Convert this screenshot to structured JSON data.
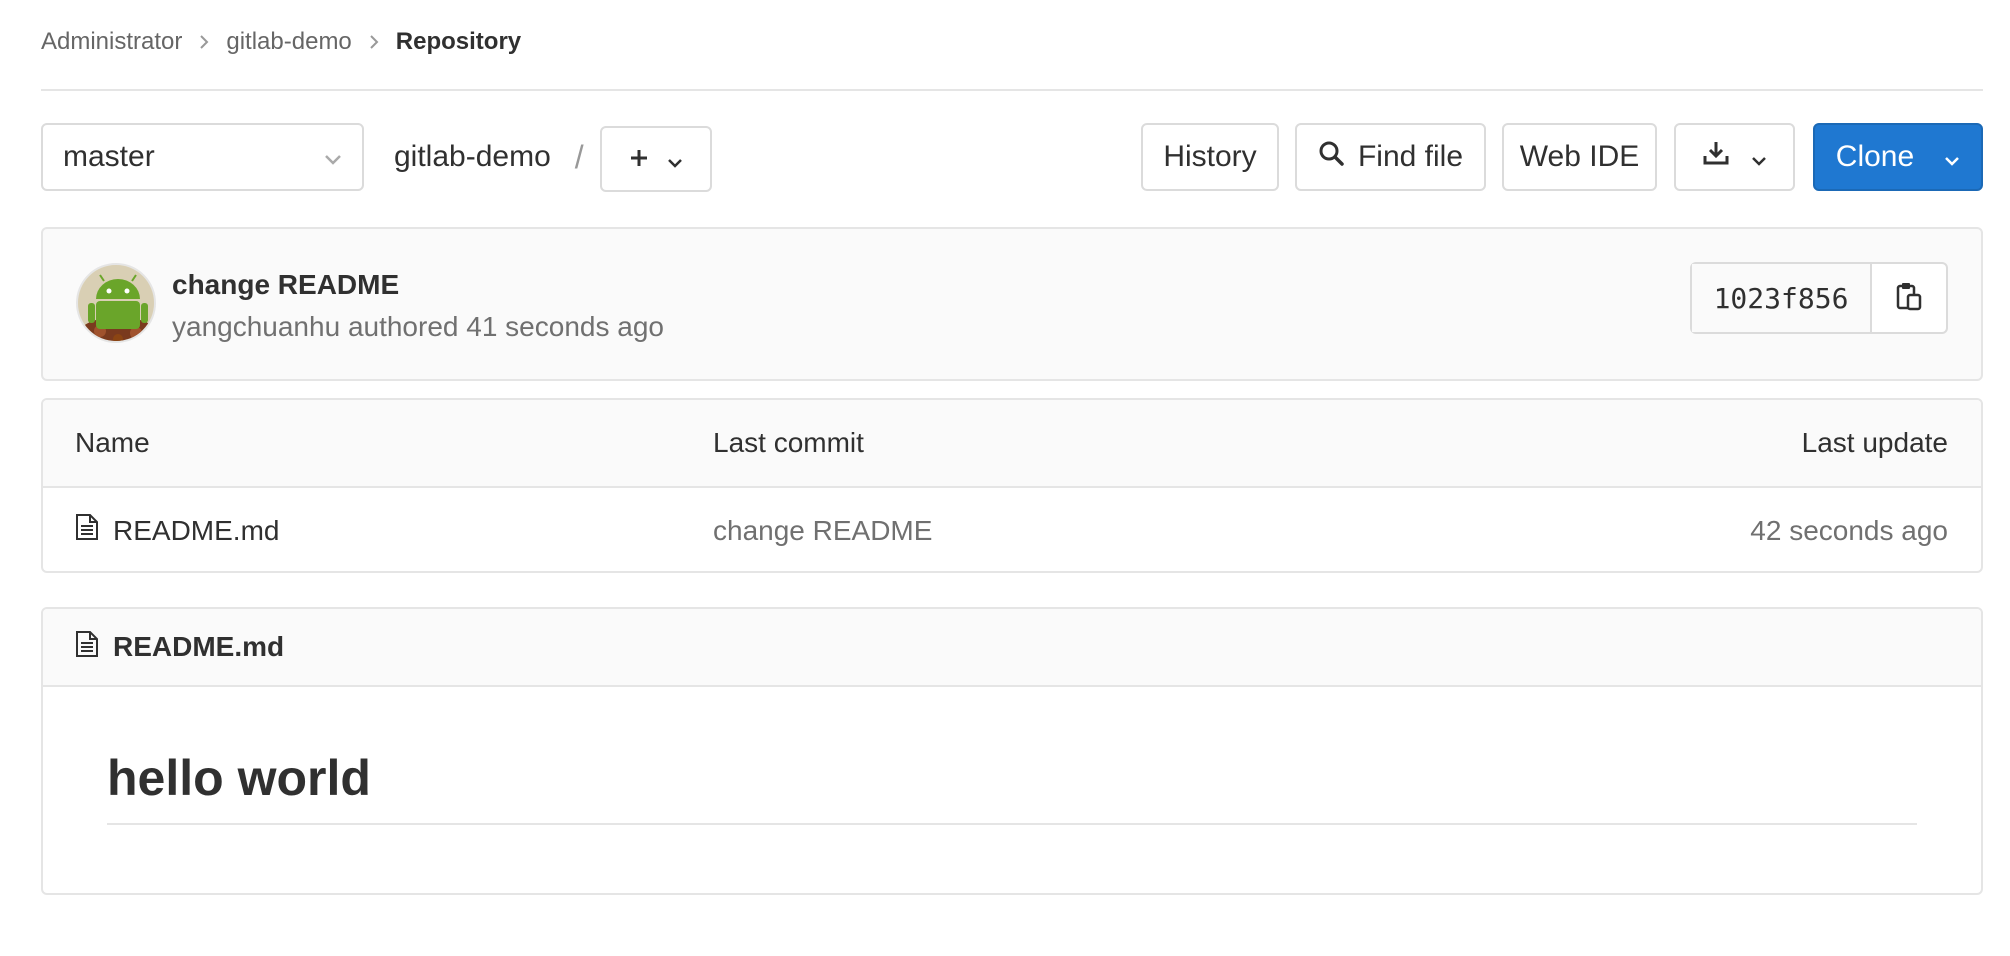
{
  "breadcrumb": {
    "items": [
      "Administrator",
      "gitlab-demo"
    ],
    "current": "Repository"
  },
  "toolbar": {
    "branch": "master",
    "project_path": "gitlab-demo",
    "path_separator": "/",
    "history_label": "History",
    "find_file_label": "Find file",
    "web_ide_label": "Web IDE",
    "clone_label": "Clone"
  },
  "last_commit": {
    "title": "change README",
    "author": "yangchuanhu",
    "meta": "authored 41 seconds ago",
    "sha": "1023f856"
  },
  "file_table": {
    "columns": [
      "Name",
      "Last commit",
      "Last update"
    ],
    "rows": [
      {
        "name": "README.md",
        "last_commit": "change README",
        "last_update": "42 seconds ago"
      }
    ]
  },
  "readme": {
    "filename": "README.md",
    "heading": "hello world"
  },
  "colors": {
    "primary": "#1f78d1",
    "border": "#e5e5e5",
    "muted_text": "#707070"
  }
}
